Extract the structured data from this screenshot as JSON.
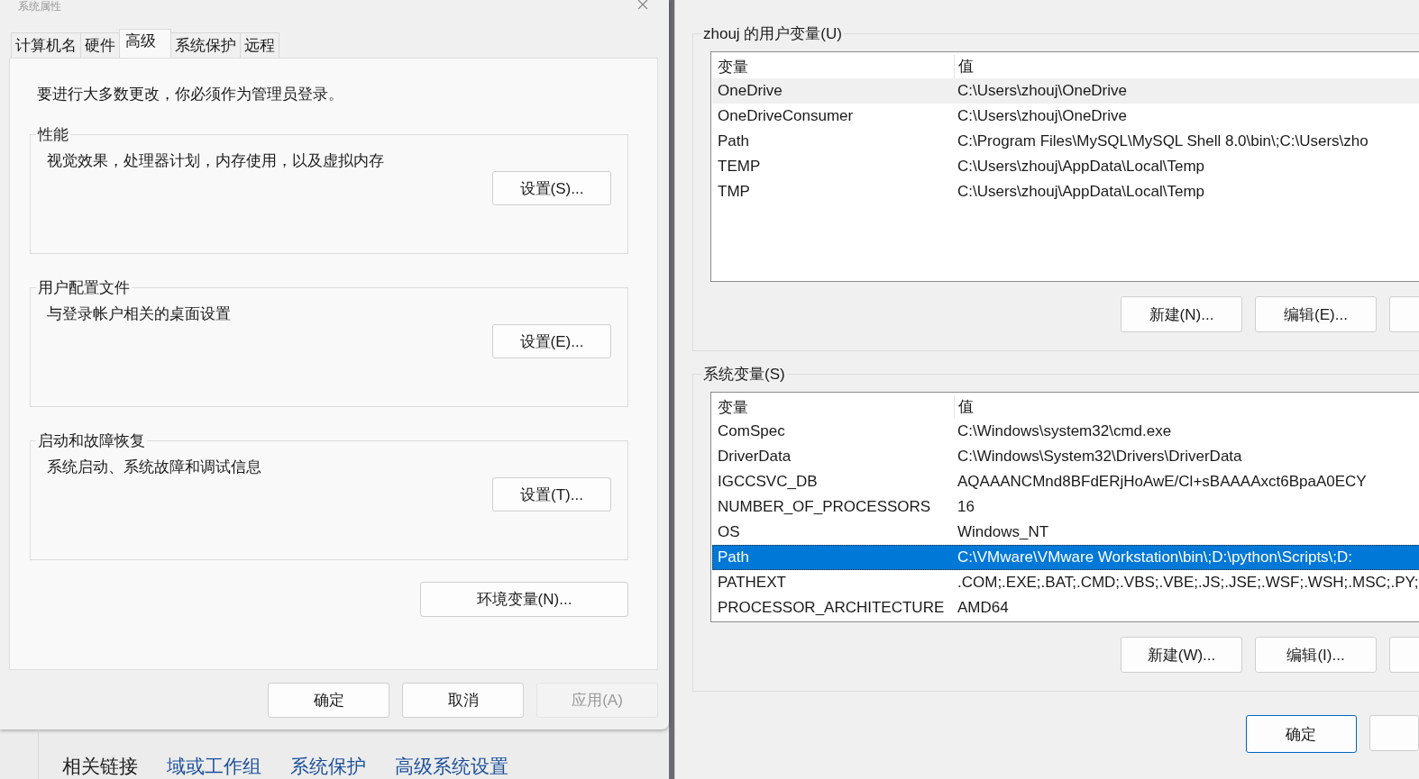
{
  "window": {
    "title": "系统属性"
  },
  "tabs": [
    {
      "label": "计算机名",
      "selected": false
    },
    {
      "label": "硬件",
      "selected": false
    },
    {
      "label": "高级",
      "selected": true
    },
    {
      "label": "系统保护",
      "selected": false
    },
    {
      "label": "远程",
      "selected": false
    }
  ],
  "notice": "要进行大多数更改，你必须作为管理员登录。",
  "groups": [
    {
      "title": "性能",
      "description": "视觉效果，处理器计划，内存使用，以及虚拟内存",
      "button": "设置(S)..."
    },
    {
      "title": "用户配置文件",
      "description": "与登录帐户相关的桌面设置",
      "button": "设置(E)..."
    },
    {
      "title": "启动和故障恢复",
      "description": "系统启动、系统故障和调试信息",
      "button": "设置(T)..."
    }
  ],
  "env_button": "环境变量(N)...",
  "dialog_buttons": [
    {
      "label": "确定",
      "disabled": false
    },
    {
      "label": "取消",
      "disabled": false
    },
    {
      "label": "应用(A)",
      "disabled": true
    }
  ],
  "related_links": {
    "label": "相关链接",
    "links": [
      "域或工作组",
      "系统保护",
      "高级系统设置"
    ]
  },
  "env_dialog": {
    "sections": [
      {
        "title": "zhouj 的用户变量(U)",
        "focused": false,
        "columns": [
          "变量",
          "值"
        ],
        "rows": [
          {
            "name": "OneDrive",
            "value": "C:\\Users\\zhouj\\OneDrive",
            "selected": true
          },
          {
            "name": "OneDriveConsumer",
            "value": "C:\\Users\\zhouj\\OneDrive",
            "selected": false
          },
          {
            "name": "Path",
            "value": "C:\\Program Files\\MySQL\\MySQL Shell 8.0\\bin\\;C:\\Users\\zho",
            "selected": false
          },
          {
            "name": "TEMP",
            "value": "C:\\Users\\zhouj\\AppData\\Local\\Temp",
            "selected": false
          },
          {
            "name": "TMP",
            "value": "C:\\Users\\zhouj\\AppData\\Local\\Temp",
            "selected": false
          }
        ],
        "buttons": [
          "新建(N)...",
          "编辑(E)..."
        ]
      },
      {
        "title": "系统变量(S)",
        "focused": true,
        "columns": [
          "变量",
          "值"
        ],
        "rows": [
          {
            "name": "ComSpec",
            "value": "C:\\Windows\\system32\\cmd.exe",
            "selected": false
          },
          {
            "name": "DriverData",
            "value": "C:\\Windows\\System32\\Drivers\\DriverData",
            "selected": false
          },
          {
            "name": "IGCCSVC_DB",
            "value": "AQAAANCMnd8BFdERjHoAwE/Cl+sBAAAAxct6BpaA0ECY",
            "selected": false
          },
          {
            "name": "NUMBER_OF_PROCESSORS",
            "value": "16",
            "selected": false
          },
          {
            "name": "OS",
            "value": "Windows_NT",
            "selected": false
          },
          {
            "name": "Path",
            "value": "C:\\VMware\\VMware Workstation\\bin\\;D:\\python\\Scripts\\;D:",
            "selected": true
          },
          {
            "name": "PATHEXT",
            "value": ".COM;.EXE;.BAT;.CMD;.VBS;.VBE;.JS;.JSE;.WSF;.WSH;.MSC;.PY;",
            "selected": false
          },
          {
            "name": "PROCESSOR_ARCHITECTURE",
            "value": "AMD64",
            "selected": false
          }
        ],
        "buttons": [
          "新建(W)...",
          "编辑(I)..."
        ]
      }
    ],
    "ok_button": "确定"
  }
}
